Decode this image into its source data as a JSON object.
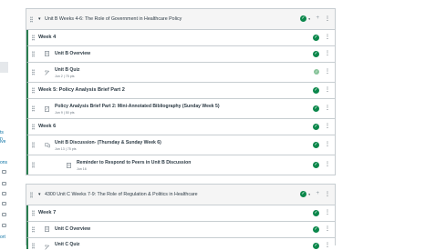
{
  "sidebar": {
    "links": [
      "ts",
      "n",
      "ive",
      "ons",
      "ort"
    ]
  },
  "modules": [
    {
      "title": "Unit B Weeks 4-6: The Role of Government in Healthcare Policy",
      "rows": [
        {
          "kind": "header",
          "title": "Week 4"
        },
        {
          "kind": "page",
          "icon": "page-icon",
          "title": "Unit B Overview"
        },
        {
          "kind": "quiz",
          "icon": "quiz-icon",
          "title": "Unit B Quiz",
          "meta": "Jun 2 | 75 pts"
        },
        {
          "kind": "header",
          "title": "Week 5: Policy Analysis Brief Part 2"
        },
        {
          "kind": "assignment",
          "icon": "assignment-icon",
          "title": "Policy Analysis Brief Part 2: Mini-Annotated Bibliography (Sunday Week 5)",
          "meta": "Jun 9 | 50 pts"
        },
        {
          "kind": "header",
          "title": "Week 6"
        },
        {
          "kind": "discussion",
          "icon": "discussion-icon",
          "title": "Unit B Discussion- (Thursday & Sunday Week 6)",
          "meta": "Jun 13 | 75 pts"
        },
        {
          "kind": "page",
          "icon": "page-icon",
          "title": "Reminder to Respond to Peers in Unit B Discussion",
          "meta": "Jun 16"
        }
      ]
    },
    {
      "title": "4300 Unit C Weeks 7-9: The Role of Regulation & Politics in Healthcare",
      "rows": [
        {
          "kind": "header",
          "title": "Week 7"
        },
        {
          "kind": "page",
          "icon": "page-icon",
          "title": "Unit C Overview"
        },
        {
          "kind": "quiz",
          "icon": "quiz-icon",
          "title": "Unit C Quiz"
        }
      ]
    }
  ],
  "colors": {
    "published": "#0b874b",
    "indent_bar": "#2a7e4f",
    "header_bg": "#f5f5f5"
  },
  "icons": {
    "published": "check-circle-icon",
    "more": "kebab-menu-icon",
    "add": "plus-icon",
    "drag": "drag-handle-icon"
  }
}
